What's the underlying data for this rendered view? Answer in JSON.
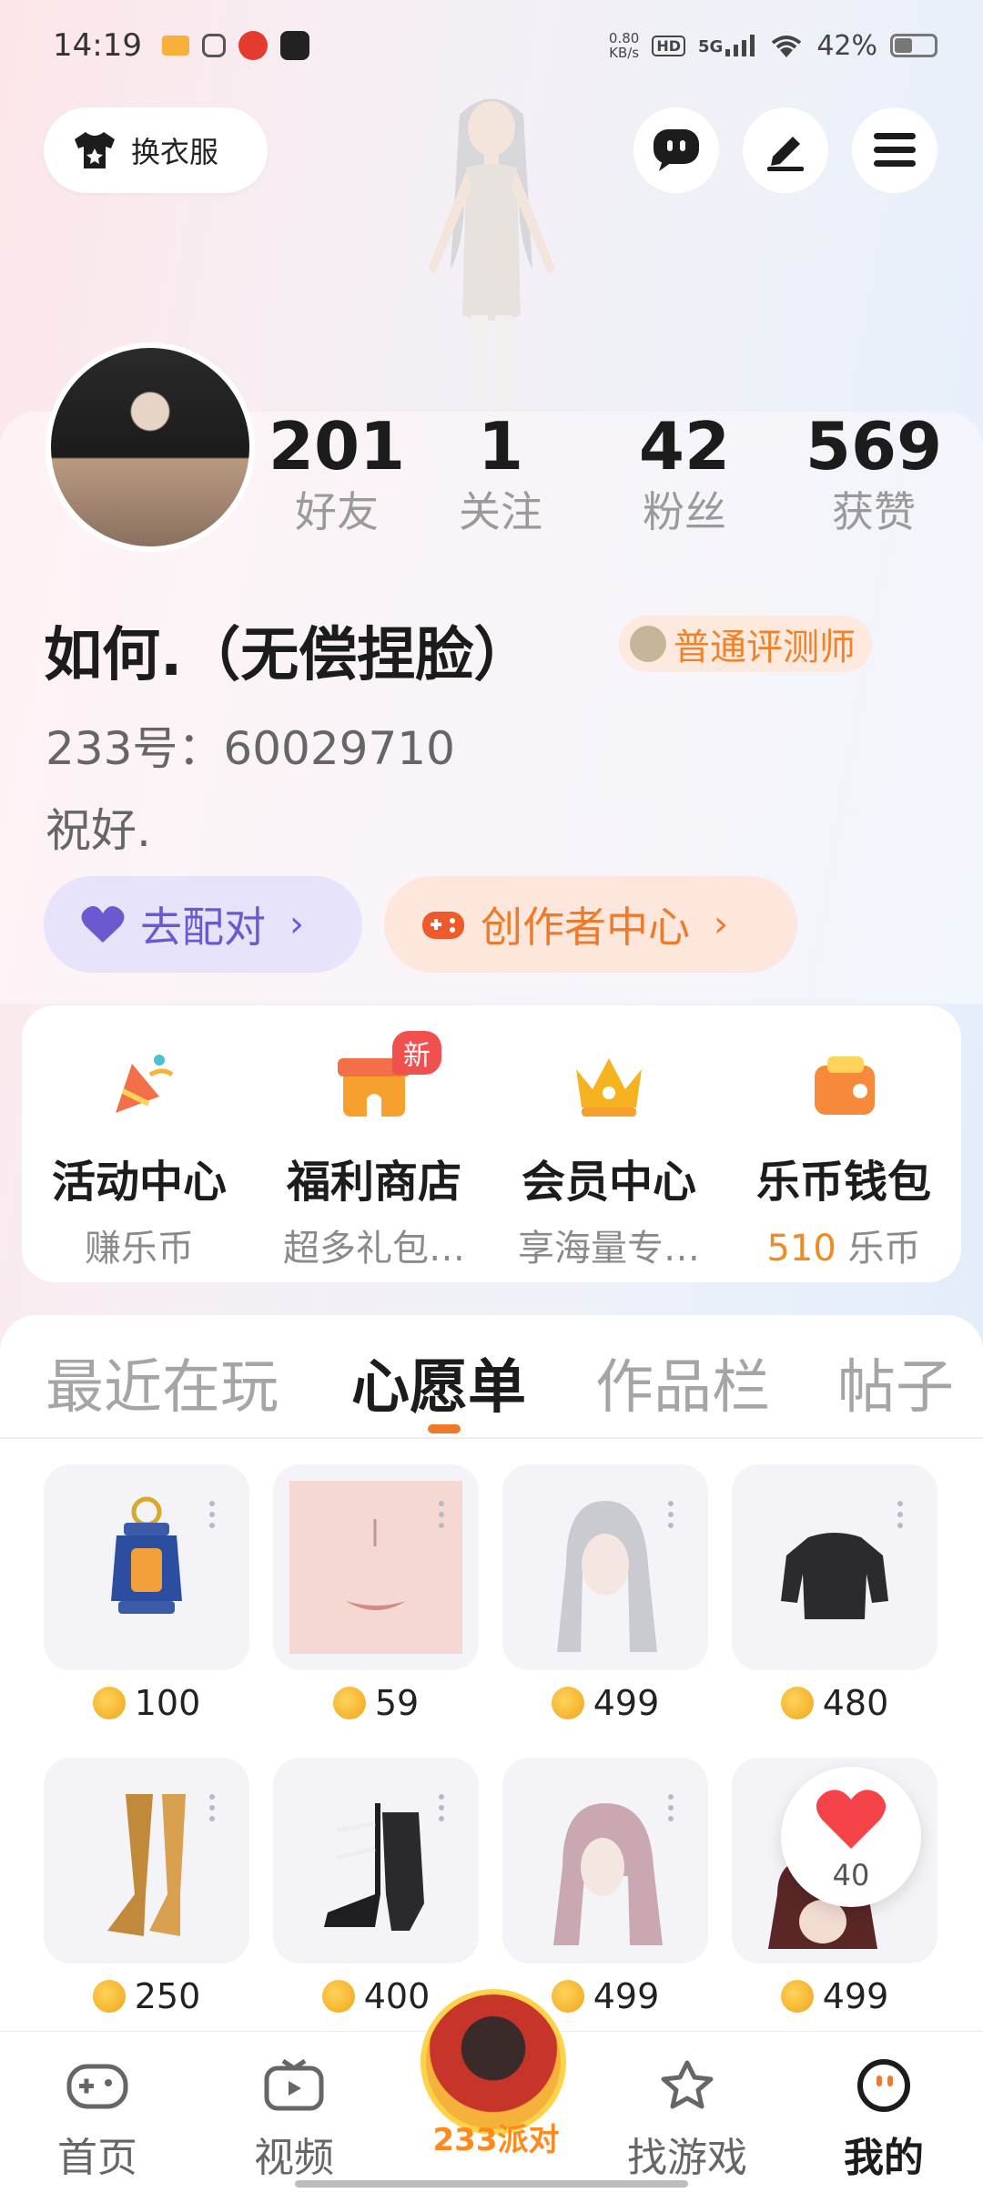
{
  "status_bar": {
    "time": "14:19",
    "net_speed": "0.80",
    "net_unit": "KB/s",
    "hd": "HD",
    "signal": "5G",
    "battery": "42%"
  },
  "header": {
    "outfit_label": "换衣服"
  },
  "profile": {
    "stats": [
      {
        "value": "201",
        "label": "好友"
      },
      {
        "value": "1",
        "label": "关注"
      },
      {
        "value": "42",
        "label": "粉丝"
      },
      {
        "value": "569",
        "label": "获赞"
      }
    ],
    "nickname": "如何.（无偿捏脸）",
    "badge": "普通评测师",
    "uid": "233号：60029710",
    "bio": "祝好.",
    "match_label": "去配对",
    "creator_label": "创作者中心"
  },
  "features": [
    {
      "name": "活动中心",
      "sub": "赚乐币"
    },
    {
      "name": "福利商店",
      "sub": "超多礼包…",
      "tag": "新"
    },
    {
      "name": "会员中心",
      "sub": "享海量专…"
    },
    {
      "name": "乐币钱包",
      "sub_value": "510",
      "sub_unit": "乐币"
    }
  ],
  "tabs": [
    {
      "label": "最近在玩"
    },
    {
      "label": "心愿单"
    },
    {
      "label": "作品栏"
    },
    {
      "label": "帖子"
    }
  ],
  "wishlist": [
    {
      "price": "100",
      "icon": "lantern-icon"
    },
    {
      "price": "59",
      "icon": "face-lips-icon"
    },
    {
      "price": "499",
      "icon": "white-hair-icon"
    },
    {
      "price": "480",
      "icon": "black-hoodie-icon"
    },
    {
      "price": "250",
      "icon": "gold-heels-icon"
    },
    {
      "price": "400",
      "icon": "black-boots-icon"
    },
    {
      "price": "499",
      "icon": "pink-hair-icon"
    },
    {
      "price": "499",
      "icon": "dark-hair-icon"
    }
  ],
  "like_bubble": {
    "count": "40"
  },
  "bottom_nav": [
    {
      "label": "首页"
    },
    {
      "label": "视频"
    },
    {
      "label": "233派对"
    },
    {
      "label": "找游戏"
    },
    {
      "label": "我的"
    }
  ],
  "colors": {
    "accent": "#f07a2a",
    "match": "#6a5ad0",
    "new_tag": "#f0504e"
  }
}
